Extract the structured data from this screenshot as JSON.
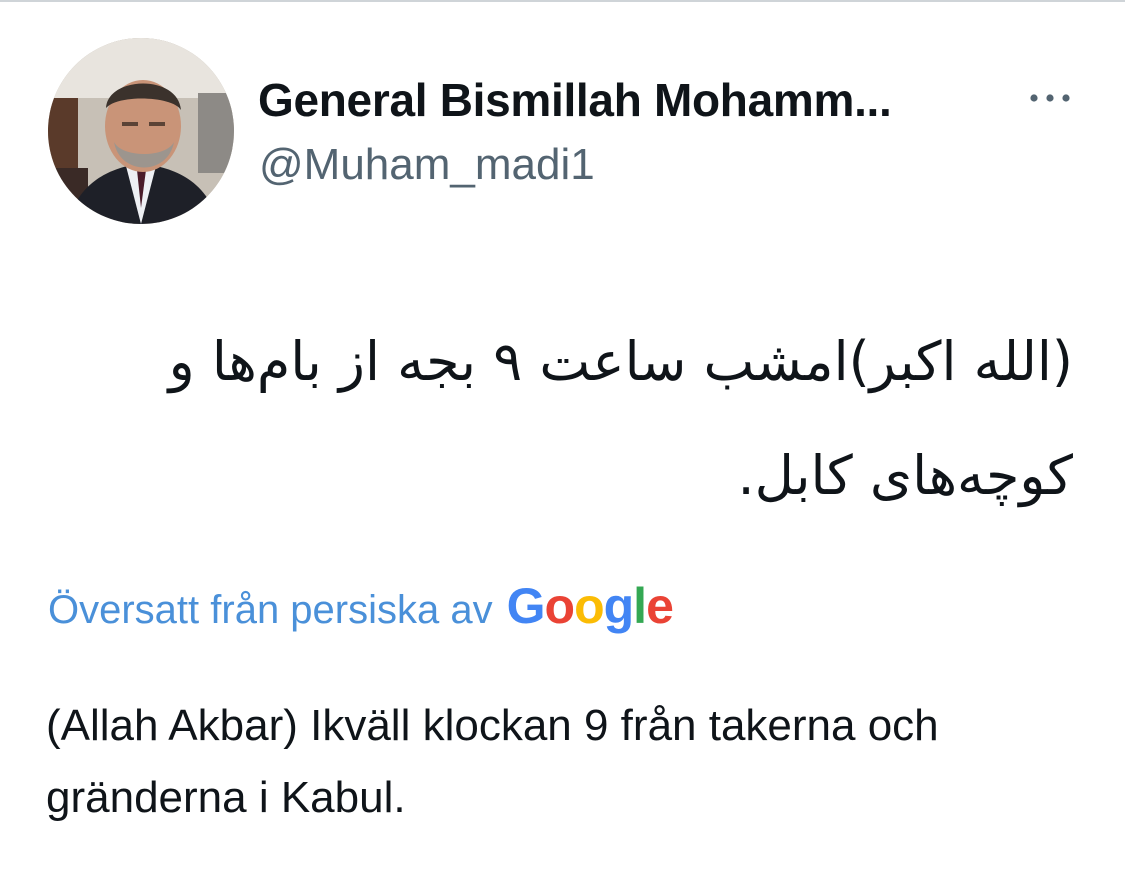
{
  "tweet": {
    "author": {
      "display_name": "General Bismillah Mohamm...",
      "handle": "@Muham_madi1"
    },
    "more_icon": "ellipsis-horizontal-icon",
    "text_original": "(الله اکبر)امشب ساعت ۹ بجه از بام‌ها و کوچه‌های کابل.",
    "translation": {
      "note": "Översatt från persiska av",
      "provider_letters": [
        "G",
        "o",
        "o",
        "g",
        "l",
        "e"
      ],
      "provider_colors": [
        "#4285F4",
        "#EA4335",
        "#FBBC05",
        "#4285F4",
        "#34A853",
        "#EA4335"
      ]
    },
    "text_translated": "(Allah Akbar) Ikväll klockan 9 från takerna och gränderna i Kabul."
  },
  "colors": {
    "link_blue": "#4a90d9",
    "handle_gray": "#536471",
    "text": "#0f1419"
  }
}
